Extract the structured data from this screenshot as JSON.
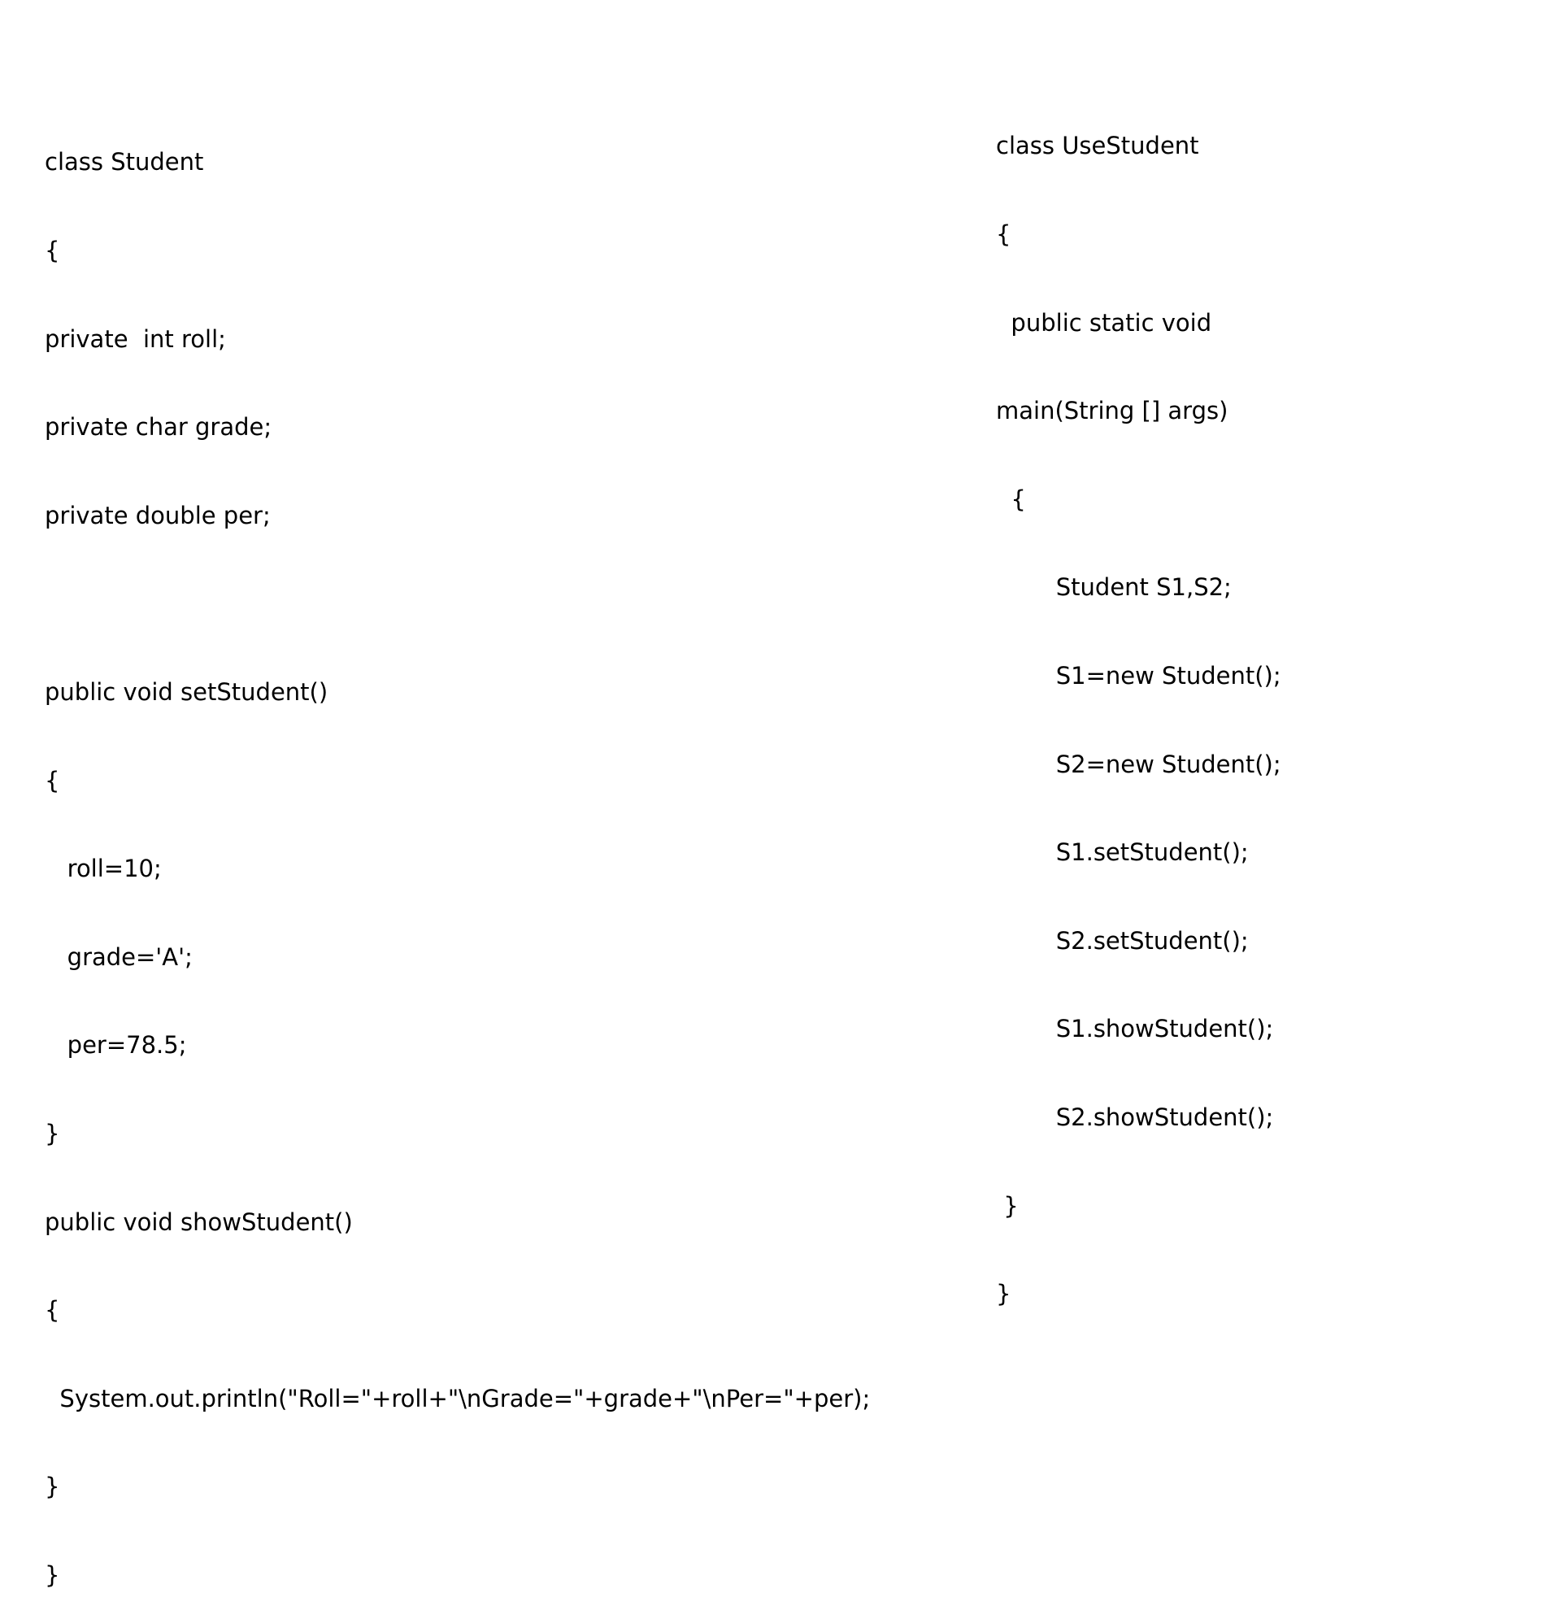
{
  "left_code": {
    "lines": [
      "class Student",
      "{",
      "private  int roll;",
      "private char grade;",
      "private double per;",
      "",
      "public void setStudent()",
      "{",
      "   roll=10;",
      "   grade='A';",
      "   per=78.5;",
      "}",
      "public void showStudent()",
      "{",
      "  System.out.println(\"Roll=\"+roll+\"\\nGrade=\"+grade+\"\\nPer=\"+per);",
      "}",
      "}"
    ]
  },
  "right_code": {
    "lines": [
      "class UseStudent",
      "{",
      "  public static void",
      "main(String [] args)",
      "  {",
      "        Student S1,S2;",
      "        S1=new Student();",
      "        S2=new Student();",
      "        S1.setStudent();",
      "        S2.setStudent();",
      "        S1.showStudent();",
      "        S2.showStudent();",
      " }",
      "}"
    ]
  }
}
